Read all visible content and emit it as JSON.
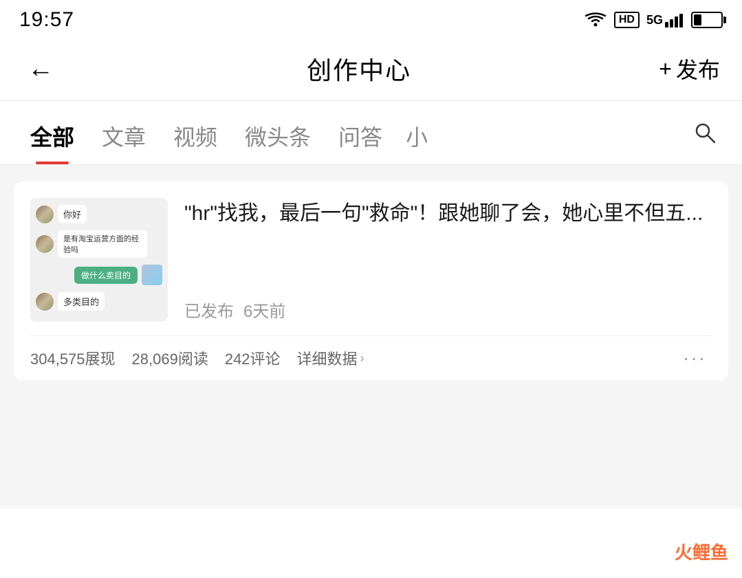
{
  "status_bar": {
    "time": "19:57",
    "wifi_icon": "wifi",
    "hd_label": "HD",
    "signal_5g": "5G",
    "battery_level": 30
  },
  "nav": {
    "back_icon": "←",
    "title": "创作中心",
    "publish_plus": "+",
    "publish_label": "发布"
  },
  "tabs": [
    {
      "id": "all",
      "label": "全部",
      "active": true
    },
    {
      "id": "article",
      "label": "文章",
      "active": false
    },
    {
      "id": "video",
      "label": "视频",
      "active": false
    },
    {
      "id": "micro",
      "label": "微头条",
      "active": false
    },
    {
      "id": "qa",
      "label": "问答",
      "active": false
    },
    {
      "id": "small",
      "label": "小",
      "active": false
    }
  ],
  "search_icon": "🔍",
  "articles": [
    {
      "id": 1,
      "title": "\"hr\"找我，最后一句\"救命\"！跟她聊了会，她心里不但五...",
      "status": "已发布",
      "time_ago": "6天前",
      "stats": {
        "views": "304,575展现",
        "reads": "28,069阅读",
        "comments": "242评论",
        "detail_link": "详细数据"
      },
      "thumb": {
        "chat_lines": [
          {
            "type": "received",
            "avatar": true,
            "text": "你好"
          },
          {
            "type": "received",
            "avatar": true,
            "text": "是有淘宝运营方面的经验吗"
          },
          {
            "type": "sent",
            "text": "做什么卖目的"
          },
          {
            "type": "sent",
            "img": true
          },
          {
            "type": "received",
            "avatar": true,
            "text": "多类目的"
          }
        ]
      }
    }
  ],
  "watermark": {
    "part1": "火鲤",
    "part2": "鱼"
  }
}
